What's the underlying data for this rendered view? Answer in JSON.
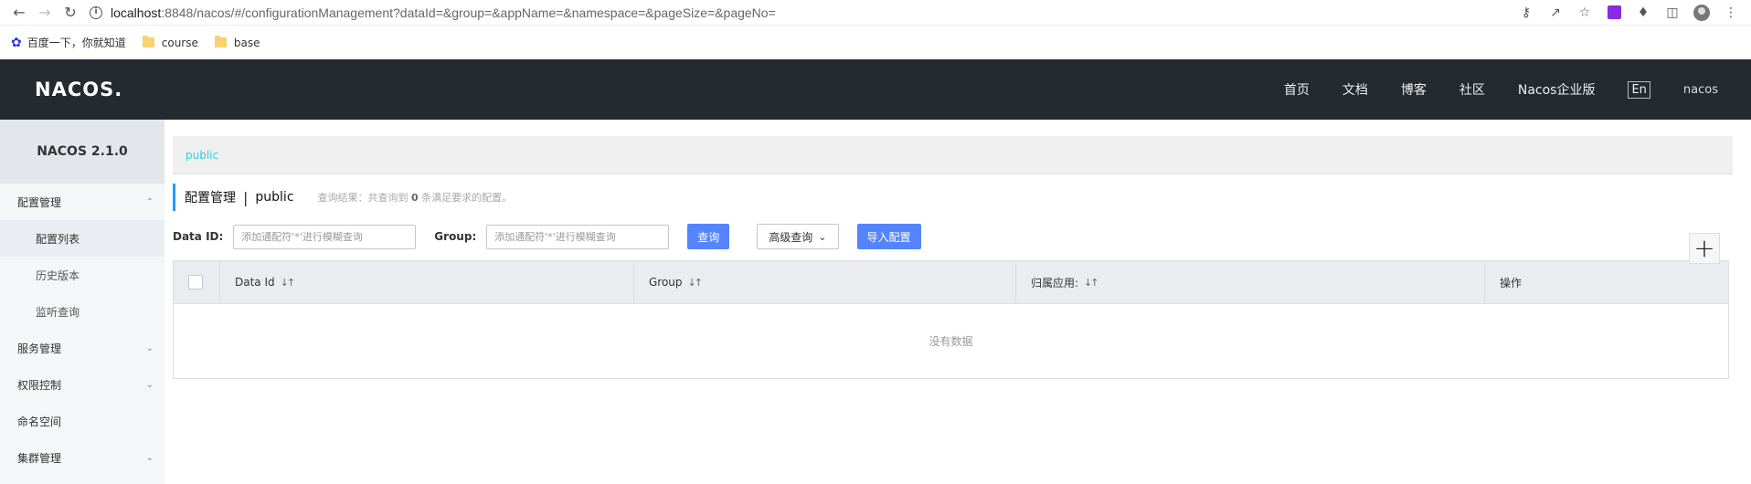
{
  "browser": {
    "url_host": "localhost",
    "url_rest": ":8848/nacos/#/configurationManagement?dataId=&group=&appName=&namespace=&pageSize=&pageNo=",
    "bookmarks": [
      "百度一下，你就知道",
      "course",
      "base"
    ]
  },
  "header": {
    "logo": "NACOS.",
    "nav": [
      "首页",
      "文档",
      "博客",
      "社区",
      "Nacos企业版"
    ],
    "lang": "En",
    "user": "nacos"
  },
  "sidebar": {
    "version": "NACOS 2.1.0",
    "config_mgmt": "配置管理",
    "config_list": "配置列表",
    "history": "历史版本",
    "listen_query": "监听查询",
    "service_mgmt": "服务管理",
    "auth_ctrl": "权限控制",
    "namespace": "命名空间",
    "cluster_mgmt": "集群管理"
  },
  "content": {
    "namespace_link": "public",
    "title": "配置管理",
    "separator": "|",
    "title_ns": "public",
    "summary_prefix": "查询结果：共查询到",
    "summary_count": "0",
    "summary_suffix": "条满足要求的配置。",
    "dataid_label": "Data ID:",
    "dataid_placeholder": "添加通配符'*'进行模糊查询",
    "group_label": "Group:",
    "group_placeholder": "添加通配符'*'进行模糊查询",
    "query_btn": "查询",
    "advanced_btn": "高级查询",
    "import_btn": "导入配置",
    "plus": "+"
  },
  "table": {
    "columns": [
      "Data Id",
      "Group",
      "归属应用:",
      "操作"
    ],
    "empty_text": "没有数据"
  }
}
